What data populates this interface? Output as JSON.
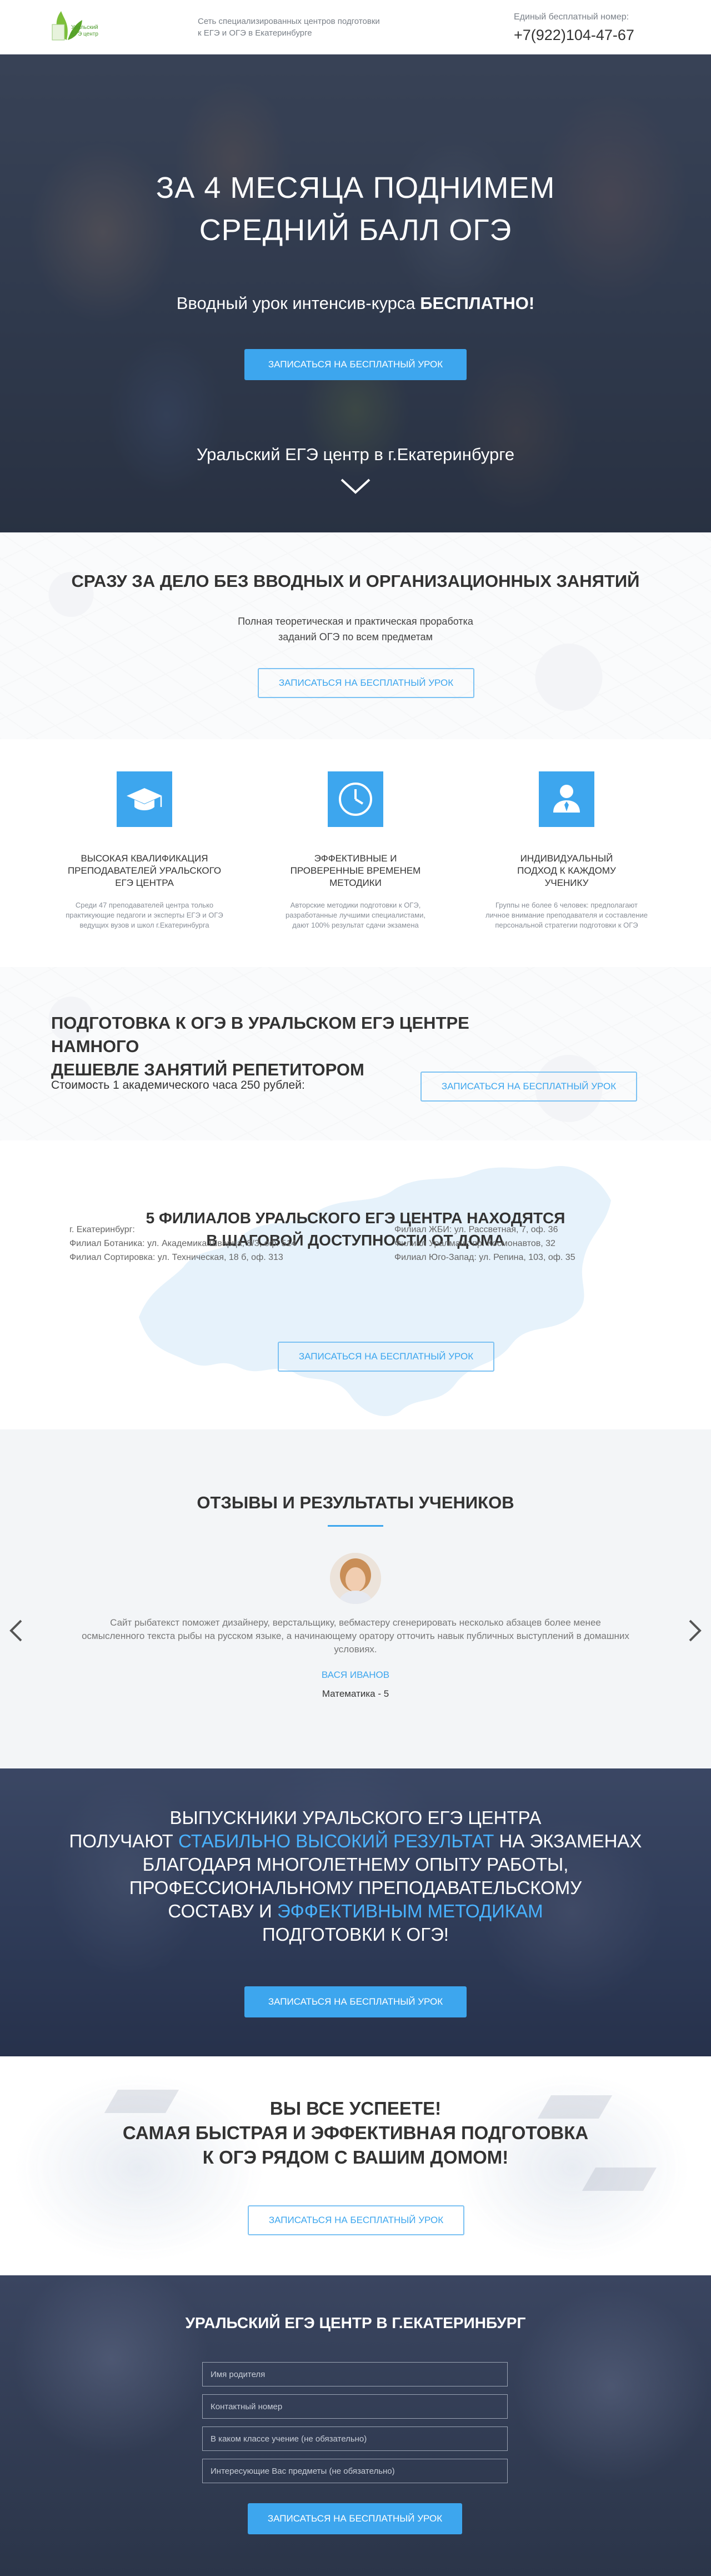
{
  "header": {
    "logo_text_1": "Уральский",
    "logo_text_2": "ЕГЭ центр",
    "tagline_1": "Сеть специализированных центров подготовки",
    "tagline_2": "к ЕГЭ и ОГЭ в Екатеринбурге",
    "phone_label": "Единый бесплатный номер:",
    "phone_number": "+7(922)104-47-67"
  },
  "hero": {
    "title_1": "ЗА 4 МЕСЯЦА ПОДНИМЕМ",
    "title_2": "СРЕДНИЙ БАЛЛ ОГЭ",
    "subtitle_prefix": "Вводный урок интенсив-курса ",
    "subtitle_strong": "БЕСПЛАТНО!",
    "button": "Записаться на бесплатный урок",
    "city": "Уральский ЕГЭ центр в г.Екатеринбурге"
  },
  "direct": {
    "title": "СРАЗУ ЗА ДЕЛО БЕЗ ВВОДНЫХ И ОРГАНИЗАЦИОННЫХ ЗАНЯТИЙ",
    "text_1": "Полная теоретическая и практическая проработка",
    "text_2": "заданий ОГЭ по всем предметам",
    "button": "Записаться на бесплатный урок"
  },
  "features": [
    {
      "icon": "graduation-cap-icon",
      "title_1": "Высокая квалификация",
      "title_2": "преподавателей Уральского",
      "title_3": "ЕГЭ центра",
      "text_1": "Среди 47 преподавателей центра только",
      "text_2": "практикующие педагоги и эксперты ЕГЭ и ОГЭ",
      "text_3": "ведущих вузов и школ г.Екатеринбурга"
    },
    {
      "icon": "clock-icon",
      "title_1": "Эффективные и",
      "title_2": "проверенные временем",
      "title_3": "методики",
      "text_1": "Авторские методики подготовки к ОГЭ,",
      "text_2": "разработанные лучшими специалистами,",
      "text_3": "дают 100% результат сдачи экзамена"
    },
    {
      "icon": "person-icon",
      "title_1": "Индивидуальный",
      "title_2": "подход к каждому",
      "title_3": "ученику",
      "text_1": "Группы не более 6 человек: предполагают",
      "text_2": "личное внимание преподавателя и составление",
      "text_3": "персональной стратегии подготовки к ОГЭ"
    }
  ],
  "price": {
    "title_1": "ПОДГОТОВКА К ОГЭ В УРАЛЬСКОМ ЕГЭ ЦЕНТРЕ НАМНОГО",
    "title_2": "ДЕШЕВЛЕ ЗАНЯТИЙ РЕПЕТИТОРОМ",
    "text": "Стоимость 1 академического часа 250 рублей:",
    "button": "Записаться на бесплатный урок"
  },
  "branches": {
    "title_1": "5 ФИЛИАЛОВ УРАЛЬСКОГО ЕГЭ ЦЕНТРА НАХОДЯТСЯ",
    "title_2": "В ШАГОВОЙ ДОСТУПНОСТИ ОТ ДОМА",
    "left": [
      "г. Екатеринбург:",
      "Филиал Ботаника: ул. Академика Шварца, 8/3, оф. 514",
      "Филиал Сортировка: ул. Техническая, 18 б, оф. 313"
    ],
    "right": [
      "Филиал ЖБИ: ул. Рассветная, 7, оф. 36",
      "Филиал Уралмаш: пр. Космонавтов, 32",
      "Филиал Юго-Запад: ул. Репина, 103, оф. 35"
    ],
    "button": "Записаться на бесплатный урок"
  },
  "reviews": {
    "title": "ОТЗЫВЫ И РЕЗУЛЬТАТЫ УЧЕНИКОВ",
    "text_1": "Сайт рыбатекст поможет дизайнеру, верстальщику, вебмастеру сгенерировать несколько абзацев более менее",
    "text_2": "осмысленного текста рыбы на русском языке, а начинающему оратору отточить навык публичных выступлений в домашних",
    "text_3": "условиях.",
    "name": "ВАСЯ ИВАНОВ",
    "result": "Математика - 5"
  },
  "grads": {
    "line_1": "ВЫПУСКНИКИ УРАЛЬСКОГО ЕГЭ ЦЕНТРА",
    "line_2_pre": "ПОЛУЧАЮТ ",
    "line_2_accent": "СТАБИЛЬНО ВЫСОКИЙ РЕЗУЛЬТАТ",
    "line_2_post": " НА ЭКЗАМЕНАХ",
    "line_3": "БЛАГОДАРЯ МНОГОЛЕТНЕМУ ОПЫТУ РАБОТЫ,",
    "line_4": "ПРОФЕССИОНАЛЬНОМУ ПРЕПОДАВАТЕЛЬСКОМУ",
    "line_5_pre": "СОСТАВУ И ",
    "line_5_accent": "ЭФФЕКТИВНЫМ МЕТОДИКАМ",
    "line_6": "ПОДГОТОВКИ К ОГЭ!",
    "button": "Записаться на бесплатный урок",
    "accent_color": "#49b2ff"
  },
  "cta": {
    "line_1": "ВЫ ВСЕ УСПЕЕТЕ!",
    "line_2": "САМАЯ БЫСТРАЯ И ЭФФЕКТИВНАЯ ПОДГОТОВКА",
    "line_3": "К ОГЭ РЯДОМ С ВАШИМ ДОМОМ!",
    "button": "Записаться на бесплатный урок"
  },
  "form": {
    "title": "УРАЛЬСКИЙ ЕГЭ ЦЕНТР В Г.ЕКАТЕРИНБУРГ",
    "placeholder_name": "Имя родителя",
    "placeholder_phone": "Контактный номер",
    "placeholder_class": "В каком классе учение (не обязательно)",
    "placeholder_subjects": "Интересующие Вас предметы (не обязательно)",
    "button": "Записаться на бесплатный урок"
  },
  "colors": {
    "accent": "#3da6ee",
    "dark_overlay": "#2f3a52"
  }
}
